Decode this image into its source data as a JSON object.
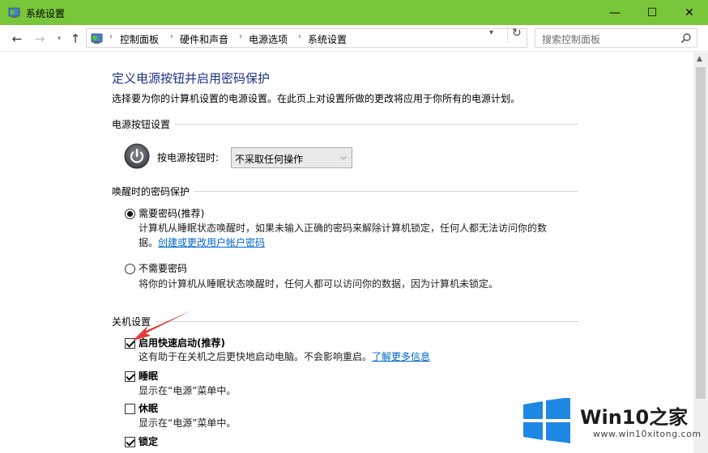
{
  "window": {
    "title": "系统设置",
    "minimize": "—",
    "maximize": "☐",
    "close": "✕"
  },
  "address": {
    "back": "←",
    "forward": "→",
    "up": "↑",
    "breadcrumb": [
      "控制面板",
      "硬件和声音",
      "电源选项",
      "系统设置"
    ],
    "search_placeholder": "搜索控制面板"
  },
  "page": {
    "title": "定义电源按钮并启用密码保护",
    "description": "选择要为你的计算机设置的电源设置。在此页上对设置所做的更改将应用于你所有的电源计划。"
  },
  "power_button": {
    "section": "电源按钮设置",
    "label": "按电源按钮时:",
    "selected": "不采取任何操作"
  },
  "wake_password": {
    "section": "唤醒时的密码保护",
    "options": [
      {
        "label": "需要密码(推荐)",
        "selected": true,
        "desc_line1": "计算机从睡眠状态唤醒时，如果未输入正确的密码来解除计算机锁定，任何人都无法访问你的数",
        "desc_line2": "据。",
        "link": "创建或更改用户帐户密码"
      },
      {
        "label": "不需要密码",
        "selected": false,
        "desc_line1": "将你的计算机从睡眠状态唤醒时，任何人都可以访问你的数据，因为计算机未锁定。"
      }
    ]
  },
  "shutdown": {
    "section": "关机设置",
    "items": [
      {
        "label": "启用快速启动(推荐)",
        "checked": true,
        "desc": "这有助于在关机之后更快地启动电脑。不会影响重启。",
        "link": "了解更多信息"
      },
      {
        "label": "睡眠",
        "checked": true,
        "desc": "显示在“电源”菜单中。"
      },
      {
        "label": "休眠",
        "checked": false,
        "desc": "显示在“电源”菜单中。"
      },
      {
        "label": "锁定",
        "checked": true,
        "desc": ""
      }
    ]
  },
  "watermark": {
    "title_part1": "Win10",
    "title_part2": "之家",
    "url": "www.win10xitong.com"
  },
  "colors": {
    "titlebar": "#7ac63b",
    "heading": "#1e3287",
    "link": "#0066cc",
    "annotation_arrow": "#e53935",
    "win_logo": "#1e88e5"
  }
}
